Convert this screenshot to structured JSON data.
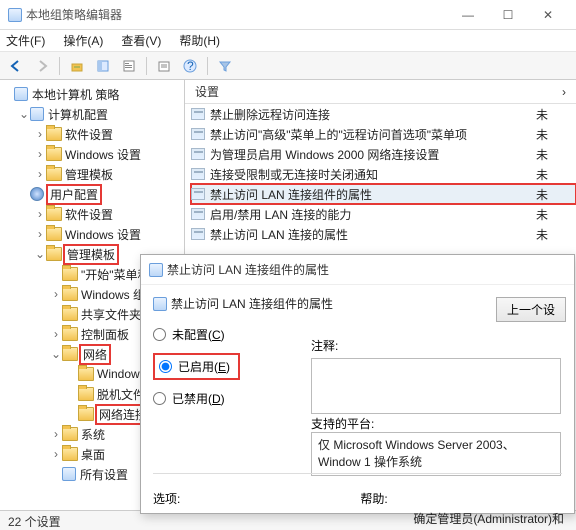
{
  "window": {
    "title": "本地组策略编辑器",
    "controls": {
      "min": "—",
      "max": "☐",
      "close": "✕"
    }
  },
  "menubar": {
    "file": "文件(F)",
    "action": "操作(A)",
    "view": "查看(V)",
    "help": "帮助(H)"
  },
  "tree": {
    "root": "本地计算机 策略",
    "computer": "计算机配置",
    "c_soft": "软件设置",
    "c_win": "Windows 设置",
    "c_tmpl": "管理模板",
    "user": "用户配置",
    "u_soft": "软件设置",
    "u_win": "Windows 设置",
    "u_tmpl": "管理模板",
    "start_menu": "\"开始\"菜单和",
    "win_components": "Windows 组",
    "shared_folders": "共享文件夹",
    "control_panel": "控制面板",
    "network": "网络",
    "n_windows": "Windows",
    "n_offline": "脱机文件",
    "n_netconn": "网络连接",
    "system": "系统",
    "desktop": "桌面",
    "all_settings": "所有设置"
  },
  "list": {
    "header_setting": "设置",
    "header_state_sym": "›",
    "rows": [
      {
        "text": "禁止删除远程访问连接",
        "state": "未"
      },
      {
        "text": "禁止访问\"高级\"菜单上的\"远程访问首选项\"菜单项",
        "state": "未"
      },
      {
        "text": "为管理员启用 Windows 2000 网络连接设置",
        "state": "未"
      },
      {
        "text": "连接受限制或无连接时关闭通知",
        "state": "未"
      },
      {
        "text": "禁止访问 LAN 连接组件的属性",
        "state": "未",
        "selected": true,
        "highlight": true
      },
      {
        "text": "启用/禁用 LAN 连接的能力",
        "state": "未"
      },
      {
        "text": "禁止访问 LAN 连接的属性",
        "state": "未"
      }
    ]
  },
  "dialog": {
    "title": "禁止访问 LAN 连接组件的属性",
    "heading": "禁止访问 LAN 连接组件的属性",
    "prev_btn": "上一个设",
    "radio_not": "未配置(C)",
    "radio_enabled": "已启用(E)",
    "radio_disabled": "已禁用(D)",
    "comment_label": "注释:",
    "platform_label": "支持的平台:",
    "platform_value": "仅 Microsoft Windows Server 2003、Window 1 操作系统",
    "options_label": "选项:",
    "help_label": "帮助:",
    "help_desc": "确定管理员(Administrator)和"
  },
  "statusbar": {
    "text": "22 个设置"
  }
}
